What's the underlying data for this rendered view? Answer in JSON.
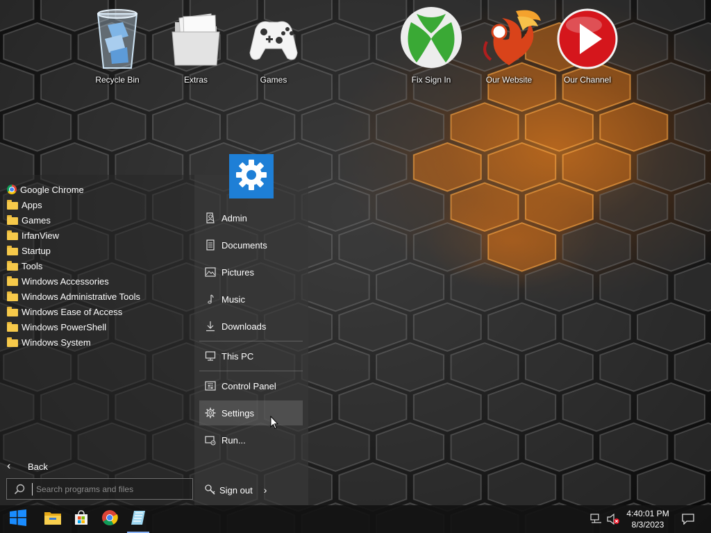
{
  "desktop": {
    "icons": [
      {
        "label": "Recycle Bin",
        "icon": "recycle-bin-icon"
      },
      {
        "label": "Extras",
        "icon": "folder-icon"
      },
      {
        "label": "Games",
        "icon": "gamepad-icon"
      },
      {
        "label": "Fix Sign In",
        "icon": "xbox-icon"
      },
      {
        "label": "Our Website",
        "icon": "phoenix-logo-icon"
      },
      {
        "label": "Our Channel",
        "icon": "play-icon"
      }
    ]
  },
  "start_menu": {
    "programs": [
      {
        "label": "Google Chrome",
        "type": "app"
      },
      {
        "label": "Apps",
        "type": "folder"
      },
      {
        "label": "Games",
        "type": "folder"
      },
      {
        "label": "IrfanView",
        "type": "folder"
      },
      {
        "label": "Startup",
        "type": "folder"
      },
      {
        "label": "Tools",
        "type": "folder"
      },
      {
        "label": "Windows Accessories",
        "type": "folder"
      },
      {
        "label": "Windows Administrative Tools",
        "type": "folder"
      },
      {
        "label": "Windows Ease of Access",
        "type": "folder"
      },
      {
        "label": "Windows PowerShell",
        "type": "folder"
      },
      {
        "label": "Windows System",
        "type": "folder"
      }
    ],
    "back_label": "Back",
    "search_placeholder": "Search programs and files",
    "right_items": [
      {
        "label": "Admin",
        "icon": "user-icon"
      },
      {
        "label": "Documents",
        "icon": "document-icon"
      },
      {
        "label": "Pictures",
        "icon": "picture-icon"
      },
      {
        "label": "Music",
        "icon": "music-note-icon"
      },
      {
        "label": "Downloads",
        "icon": "download-icon"
      },
      {
        "label": "This PC",
        "icon": "monitor-icon"
      },
      {
        "label": "Control Panel",
        "icon": "control-panel-icon"
      },
      {
        "label": "Settings",
        "icon": "gear-icon"
      },
      {
        "label": "Run...",
        "icon": "run-icon"
      }
    ],
    "signout_label": "Sign out"
  },
  "taskbar": {
    "buttons": [
      "start-icon",
      "file-explorer-icon",
      "store-icon",
      "chrome-icon",
      "notepad-icon"
    ],
    "clock": {
      "time": "4:40:01 PM",
      "date": "8/3/2023"
    }
  },
  "colors": {
    "accent": "#1e7fd6",
    "folder": "#f6c94a",
    "taskbar": "#121212"
  }
}
